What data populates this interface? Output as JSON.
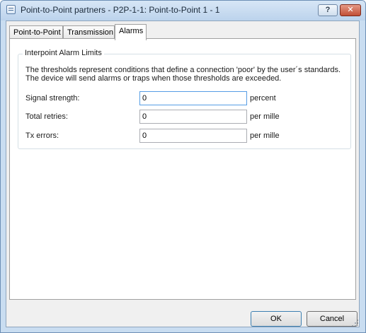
{
  "window": {
    "title": "Point-to-Point partners - P2P-1-1: Point-to-Point 1 - 1",
    "help_label": "?",
    "close_label": "✕"
  },
  "tabs": [
    {
      "label": "Point-to-Point",
      "active": false
    },
    {
      "label": "Transmission",
      "active": false
    },
    {
      "label": "Alarms",
      "active": true
    }
  ],
  "alarms": {
    "group_title": "Interpoint Alarm Limits",
    "description_line1": "The thresholds represent conditions that define a connection 'poor' by the user´s standards.",
    "description_line2": "The device will send alarms or traps when those thresholds are exceeded.",
    "fields": [
      {
        "label": "Signal strength:",
        "value": "0",
        "unit": "percent"
      },
      {
        "label": "Total retries:",
        "value": "0",
        "unit": "per mille"
      },
      {
        "label": "Tx errors:",
        "value": "0",
        "unit": "per mille"
      }
    ]
  },
  "buttons": {
    "ok_label": "OK",
    "cancel_label": "Cancel"
  }
}
